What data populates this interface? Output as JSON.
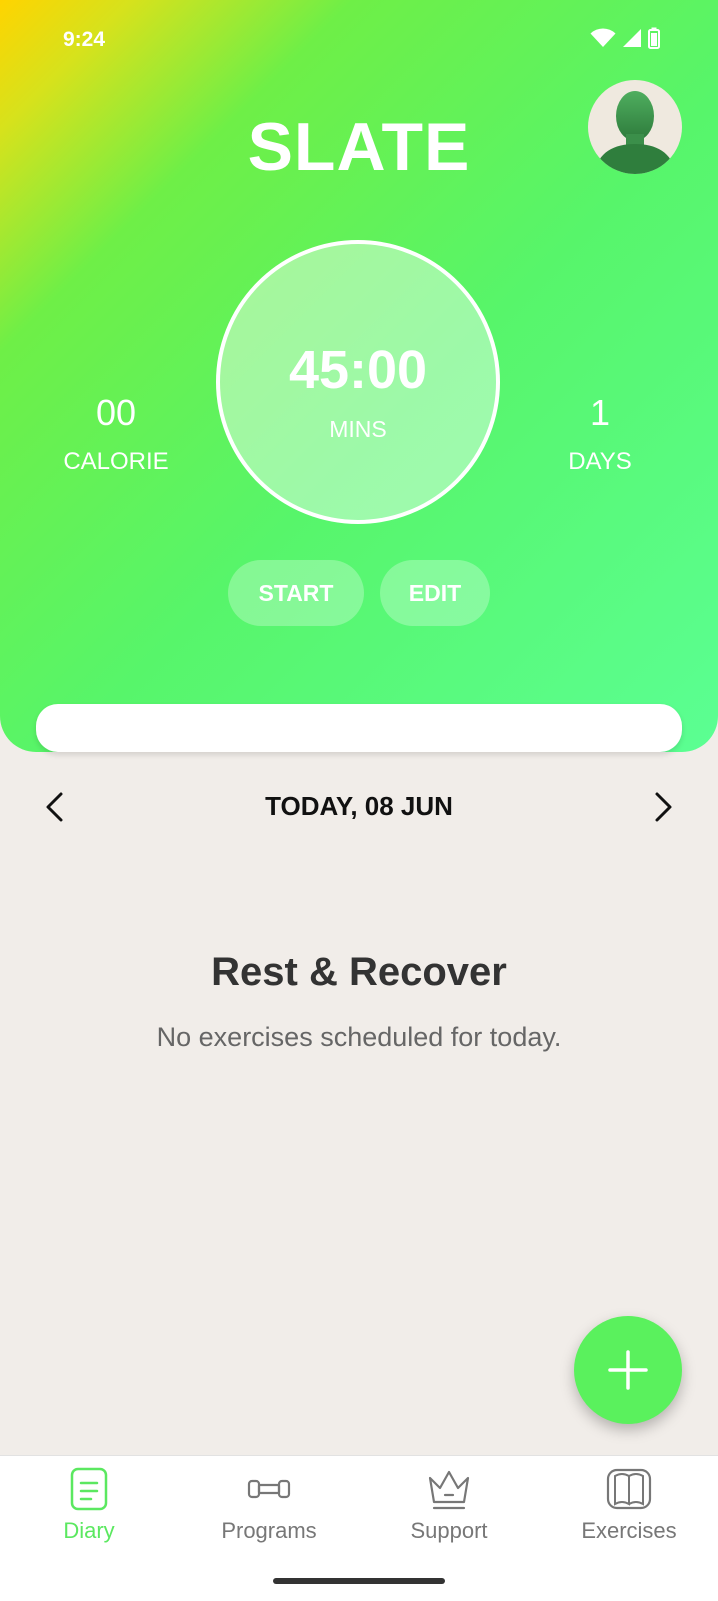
{
  "status_bar": {
    "time": "9:24"
  },
  "header": {
    "app_title": "SLATE"
  },
  "timer": {
    "value": "45:00",
    "unit": "MINS"
  },
  "stats": {
    "calorie": {
      "value": "00",
      "label": "CALORIE"
    },
    "days": {
      "value": "1",
      "label": "DAYS"
    }
  },
  "actions": {
    "start_label": "START",
    "edit_label": "EDIT"
  },
  "date_nav": {
    "label": "TODAY, 08 JUN"
  },
  "empty_state": {
    "title": "Rest & Recover",
    "subtitle": "No exercises scheduled for today."
  },
  "bottom_nav": {
    "items": [
      {
        "label": "Diary",
        "icon": "diary-icon",
        "active": true
      },
      {
        "label": "Programs",
        "icon": "dumbbell-icon",
        "active": false
      },
      {
        "label": "Support",
        "icon": "crown-icon",
        "active": false
      },
      {
        "label": "Exercises",
        "icon": "book-icon",
        "active": false
      }
    ]
  },
  "colors": {
    "accent": "#5be860",
    "fab": "#5af15d",
    "gradient_start": "#ffd400",
    "gradient_end": "#5bff93",
    "background": "#f1ede9"
  }
}
